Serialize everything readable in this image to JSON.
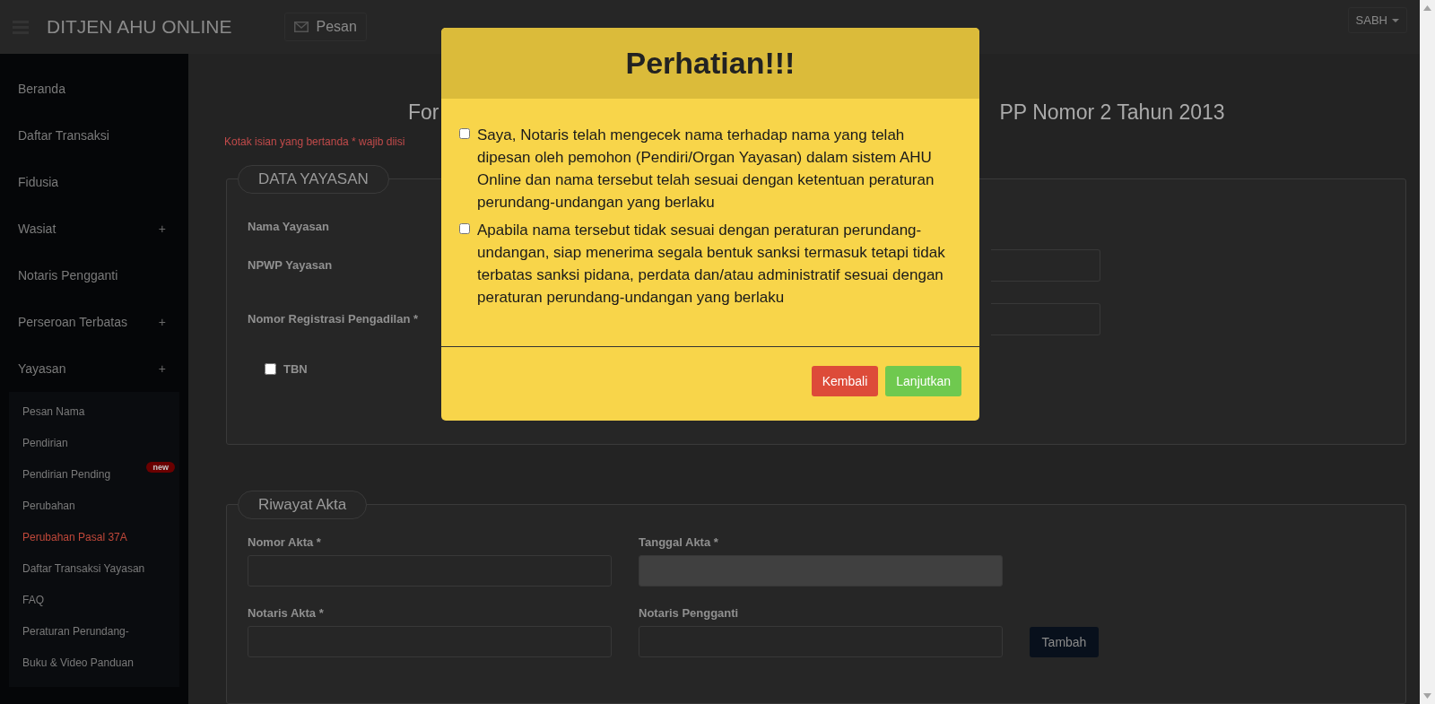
{
  "header": {
    "title": "DITJEN AHU ONLINE",
    "messages_button": "Pesan",
    "user_menu": "SABH"
  },
  "sidebar": {
    "items": [
      {
        "label": "Beranda"
      },
      {
        "label": "Daftar Transaksi"
      },
      {
        "label": "Fidusia"
      },
      {
        "label": "Wasiat",
        "expand_icon": "+"
      },
      {
        "label": "Notaris Pengganti"
      },
      {
        "label": "Perseroan Terbatas",
        "expand_icon": "+"
      },
      {
        "label": "Yayasan",
        "expand_icon": "+",
        "children": [
          {
            "label": "Pesan Nama",
            "selected": false
          },
          {
            "label": "Pendirian",
            "selected": false
          },
          {
            "label": "Pendirian Pending",
            "selected": false,
            "badge": "new"
          },
          {
            "label": "Perubahan",
            "selected": false
          },
          {
            "label": "Perubahan Pasal 37A",
            "selected": true
          },
          {
            "label": "Daftar Transaksi Yayasan",
            "selected": false
          },
          {
            "label": "FAQ",
            "selected": false
          },
          {
            "label": "Peraturan Perundang-",
            "selected": false
          },
          {
            "label": "Buku & Video Panduan",
            "selected": false
          }
        ]
      }
    ]
  },
  "page": {
    "heading_parts": [
      "For",
      "PP Nomor 2 Tahun 2013"
    ],
    "required_note": "Kotak isian yang bertanda * wajib diisi"
  },
  "data_yayasan": {
    "legend": "DATA YAYASAN",
    "fields": [
      {
        "label": "Nama Yayasan",
        "kind": "text"
      },
      {
        "label": "NPWP Yayasan",
        "kind": "input"
      },
      {
        "label": "Nomor Registrasi Pengadilan *",
        "kind": "input"
      }
    ],
    "checkbox": {
      "label": "TBN",
      "checked": false
    }
  },
  "riwayat_akta": {
    "legend": "Riwayat Akta",
    "fields": [
      {
        "label": "Nomor Akta *",
        "disabled": false
      },
      {
        "label": "Tanggal Akta *",
        "disabled": true
      },
      {
        "label": "Notaris Akta *",
        "disabled": false
      },
      {
        "label": "Notaris Pengganti",
        "disabled": false
      }
    ],
    "button": "Tambah"
  },
  "modal": {
    "title": "Perhatian!!!",
    "checks": [
      {
        "text": "Saya, Notaris telah mengecek nama terhadap nama yang telah dipesan oleh pemohon (Pendiri/Organ Yayasan) dalam sistem AHU Online dan nama tersebut telah sesuai dengan ketentuan peraturan perundang-undangan yang berlaku",
        "checked": false
      },
      {
        "text": "Apabila nama tersebut tidak sesuai dengan peraturan perundang-undangan, siap menerima segala bentuk sanksi termasuk tetapi tidak terbatas sanksi pidana, perdata dan/atau administratif sesuai dengan peraturan perundang-undangan yang berlaku",
        "checked": false
      }
    ],
    "buttons": [
      {
        "label": "Kembali",
        "kind": "danger"
      },
      {
        "label": "Lanjutkan",
        "kind": "success"
      }
    ]
  }
}
